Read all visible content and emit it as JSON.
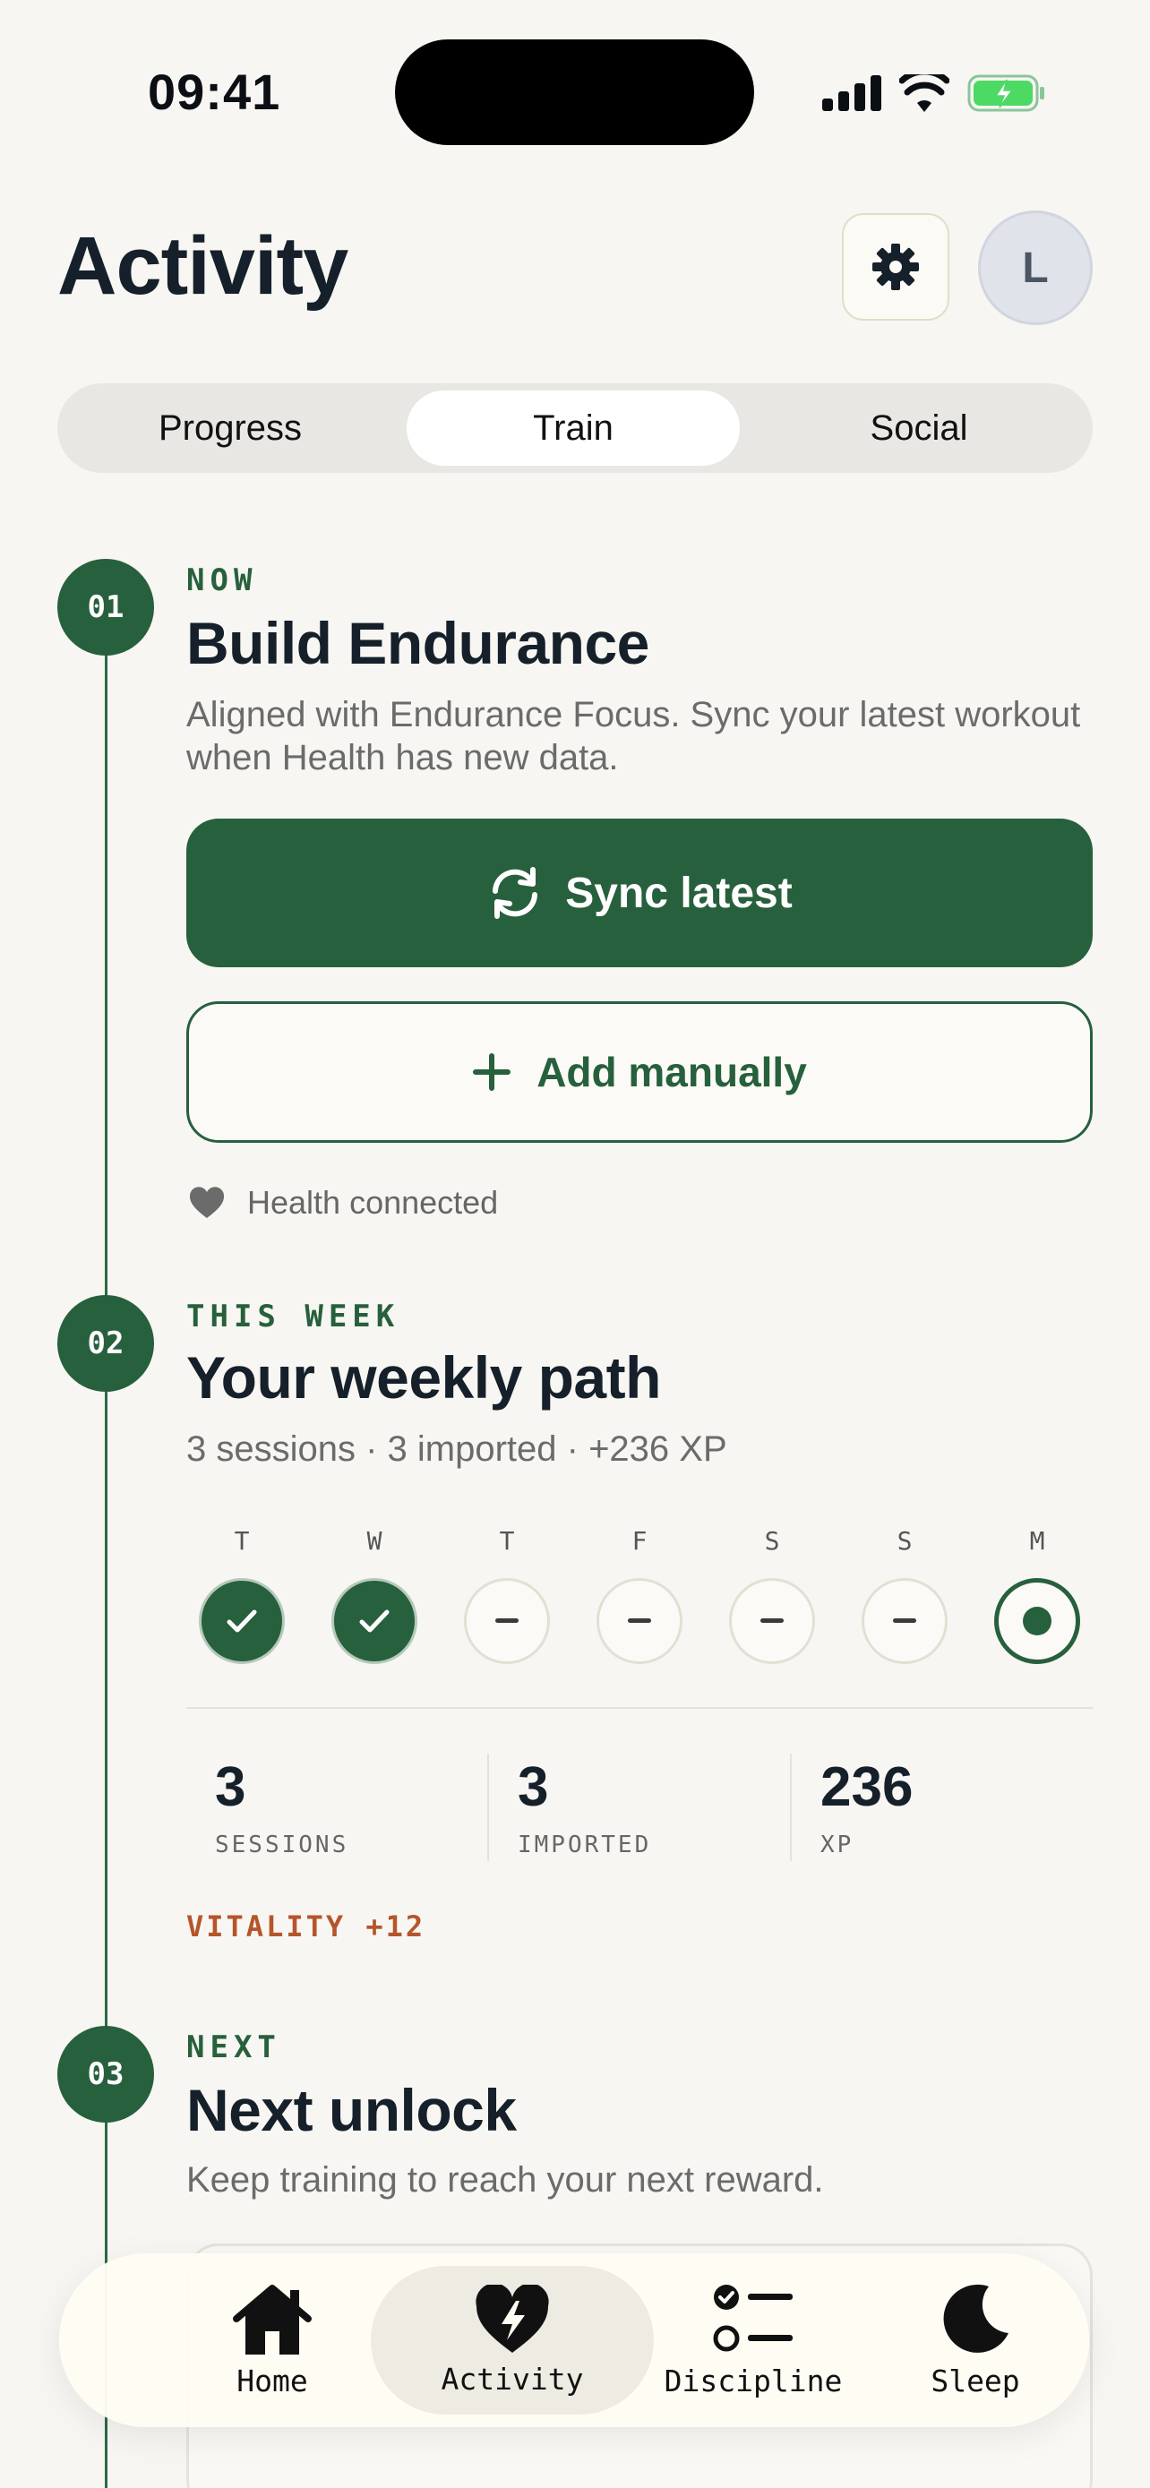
{
  "status": {
    "time": "09:41"
  },
  "header": {
    "title": "Activity",
    "avatar_initial": "L"
  },
  "segments": [
    "Progress",
    "Train",
    "Social"
  ],
  "active_segment": "Train",
  "steps": [
    {
      "num": "01",
      "eyebrow": "NOW",
      "title": "Build Endurance",
      "desc": "Aligned with Endurance Focus. Sync your latest workout when Health has new data.",
      "primary_button": "Sync latest",
      "secondary_button": "Add manually",
      "health_status": "Health connected"
    },
    {
      "num": "02",
      "eyebrow": "THIS WEEK",
      "title": "Your weekly path",
      "summary": "3 sessions · 3 imported · +236 XP",
      "days": [
        {
          "label": "T",
          "state": "done"
        },
        {
          "label": "W",
          "state": "done"
        },
        {
          "label": "T",
          "state": "empty"
        },
        {
          "label": "F",
          "state": "empty"
        },
        {
          "label": "S",
          "state": "empty"
        },
        {
          "label": "S",
          "state": "empty"
        },
        {
          "label": "M",
          "state": "today"
        }
      ],
      "stats": [
        {
          "value": "3",
          "label": "SESSIONS"
        },
        {
          "value": "3",
          "label": "IMPORTED"
        },
        {
          "value": "236",
          "label": "XP"
        }
      ],
      "vitality": "VITALITY +12"
    },
    {
      "num": "03",
      "eyebrow": "NEXT",
      "title": "Next unlock",
      "desc": "Keep training to reach your next reward."
    }
  ],
  "tabbar": [
    {
      "label": "Home",
      "icon": "home-icon"
    },
    {
      "label": "Activity",
      "icon": "heart-bolt-icon",
      "active": true
    },
    {
      "label": "Discipline",
      "icon": "checklist-icon"
    },
    {
      "label": "Sleep",
      "icon": "moon-icon"
    }
  ],
  "colors": {
    "accent": "#27603c",
    "vitality": "#b5552a",
    "background": "#f7f6f2"
  }
}
